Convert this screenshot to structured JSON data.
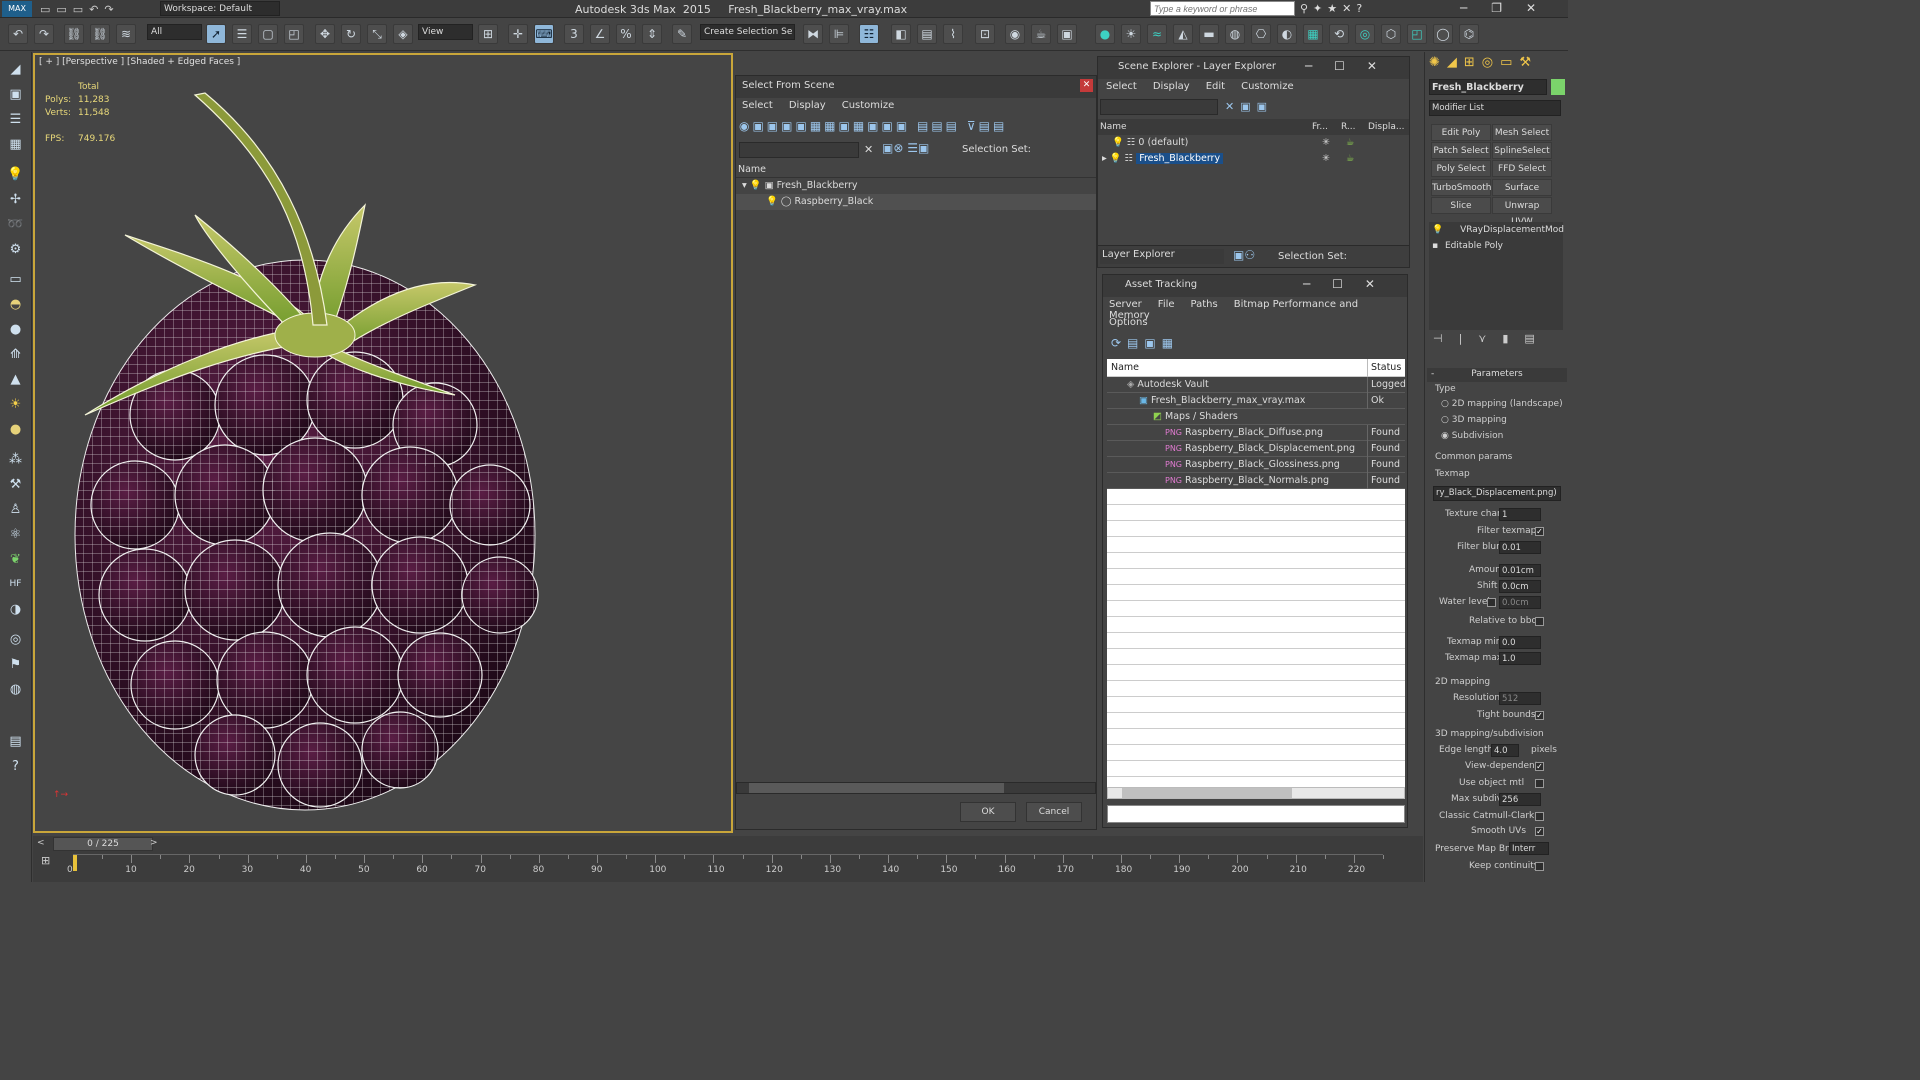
{
  "app": {
    "workspace": "Workspace: Default",
    "title": "Autodesk 3ds Max  2015     Fresh_Blackberry_max_vray.max",
    "search_placeholder": "Type a keyword or phrase"
  },
  "toolbar": {
    "filter": "All",
    "view": "View",
    "selection_set": "Create Selection Se"
  },
  "viewport": {
    "label": "[ + ] [Perspective ] [Shaded + Edged Faces ]",
    "stats": {
      "total": "Total",
      "polys_label": "Polys:",
      "polys": "11,283",
      "verts_label": "Verts:",
      "verts": "11,548",
      "fps_label": "FPS:",
      "fps": "749.176"
    }
  },
  "select_from_scene": {
    "title": "Select From Scene",
    "menu": [
      "Select",
      "Display",
      "Customize"
    ],
    "selection_set": "Selection Set:",
    "col_name": "Name",
    "items": [
      {
        "name": "Fresh_Blackberry"
      },
      {
        "name": "Raspberry_Black"
      }
    ],
    "ok": "OK",
    "cancel": "Cancel"
  },
  "scene_explorer": {
    "title": "Scene Explorer - Layer Explorer",
    "menu": [
      "Select",
      "Display",
      "Edit",
      "Customize"
    ],
    "col_name": "Name",
    "col_fr": "Fr...",
    "col_r": "R...",
    "col_disp": "Displa...",
    "layers": [
      {
        "name": "0 (default)"
      },
      {
        "name": "Fresh_Blackberry"
      }
    ],
    "footer_label": "Layer Explorer",
    "selection_set": "Selection Set:"
  },
  "asset_tracking": {
    "title": "Asset Tracking",
    "menu": [
      "Server",
      "File",
      "Paths",
      "Bitmap Performance and Memory"
    ],
    "menu2": "Options",
    "col_name": "Name",
    "col_status": "Status",
    "rows": [
      {
        "name": "Autodesk Vault",
        "status": "Logged"
      },
      {
        "name": "Fresh_Blackberry_max_vray.max",
        "status": "Ok"
      },
      {
        "name": "Maps / Shaders",
        "status": ""
      },
      {
        "name": "Raspberry_Black_Diffuse.png",
        "status": "Found"
      },
      {
        "name": "Raspberry_Black_Displacement.png",
        "status": "Found"
      },
      {
        "name": "Raspberry_Black_Glossiness.png",
        "status": "Found"
      },
      {
        "name": "Raspberry_Black_Normals.png",
        "status": "Found"
      }
    ]
  },
  "command_panel": {
    "object_name": "Fresh_Blackberry",
    "modifier_list": "Modifier List",
    "buttons": [
      "Edit Poly",
      "Mesh Select",
      "Patch Select",
      "SplineSelect",
      "Poly Select",
      "FFD Select",
      "TurboSmooth",
      "Surface Select",
      "Slice",
      "Unwrap UVW"
    ],
    "stack": [
      "VRayDisplacementMod",
      "Editable Poly"
    ],
    "params": {
      "header": "Parameters",
      "type_label": "Type",
      "type_opts": [
        "2D mapping (landscape)",
        "3D mapping",
        "Subdivision"
      ],
      "common": "Common params",
      "texmap": "Texmap",
      "texmap_val": "ry_Black_Displacement.png)",
      "texture_chan": "Texture chan",
      "texture_chan_val": "1",
      "filter_texmap": "Filter texmap",
      "filter_blur": "Filter blur",
      "filter_blur_val": "0.01",
      "amount": "Amount",
      "amount_val": "0.01cm",
      "shift": "Shift",
      "shift_val": "0.0cm",
      "water_level": "Water level",
      "water_level_val": "0.0cm",
      "relative": "Relative to bbox",
      "texmap_min": "Texmap min",
      "texmap_min_val": "0.0",
      "texmap_max": "Texmap max",
      "texmap_max_val": "1.0",
      "mapping2d": "2D mapping",
      "resolution": "Resolution",
      "resolution_val": "512",
      "tight": "Tight bounds",
      "mapping3d": "3D mapping/subdivision",
      "edge_length": "Edge length",
      "edge_length_val": "4.0",
      "pixels": "pixels",
      "view_dep": "View-dependent",
      "use_obj": "Use object mtl",
      "max_subdivs": "Max subdivs",
      "max_subdivs_val": "256",
      "classic": "Classic Catmull-Clark",
      "smooth_uvs": "Smooth UVs",
      "preserve": "Preserve Map Bnd",
      "preserve_val": "Interr",
      "keep": "Keep continuity"
    }
  },
  "timeline": {
    "frame": "0 / 225",
    "ticks": [
      "0",
      "10",
      "20",
      "30",
      "40",
      "50",
      "60",
      "70",
      "80",
      "90",
      "100",
      "110",
      "120",
      "130",
      "140",
      "150",
      "160",
      "170",
      "180",
      "190",
      "200",
      "210",
      "220"
    ]
  }
}
